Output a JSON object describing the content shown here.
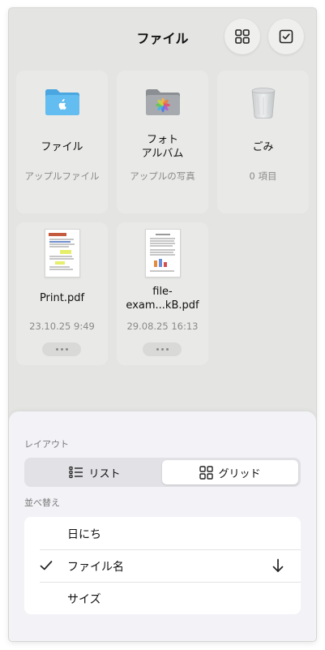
{
  "header": {
    "title": "ファイル",
    "grid_icon": "grid-view-icon",
    "select_icon": "checkbox-select-icon"
  },
  "tiles": [
    {
      "name": "ファイル",
      "subtitle": "アップルファイル",
      "icon": "blue-apple-folder-icon"
    },
    {
      "name_line1": "フォト",
      "name_line2": "アルバム",
      "subtitle": "アップルの写真",
      "icon": "photos-folder-icon"
    },
    {
      "name": "ごみ",
      "subtitle": "0 項目",
      "icon": "trash-bin-icon"
    },
    {
      "name": "Print.pdf",
      "subtitle": "23.10.25 9:49",
      "icon": "pdf-document-thumbnail"
    },
    {
      "name_line1": "file-",
      "name_line2": "exam...kB.pdf",
      "subtitle": "29.08.25 16:13",
      "icon": "pdf-document-thumbnail"
    }
  ],
  "sheet": {
    "layout_label": "レイアウト",
    "layout_options": {
      "list": "リスト",
      "grid": "グリッド",
      "selected": "grid"
    },
    "sort_label": "並べ替え",
    "sort_options": [
      {
        "label": "日にち"
      },
      {
        "label": "ファイル名"
      },
      {
        "label": "サイズ"
      }
    ],
    "sort_selected": "ファイル名",
    "sort_direction": "descending"
  },
  "colors": {
    "background": "#e4e5e2",
    "tile": "#e9eae7",
    "folder_blue": "#5ab4ea",
    "folder_gray": "#9fa3a8",
    "sheet": "#f2f2f7"
  }
}
